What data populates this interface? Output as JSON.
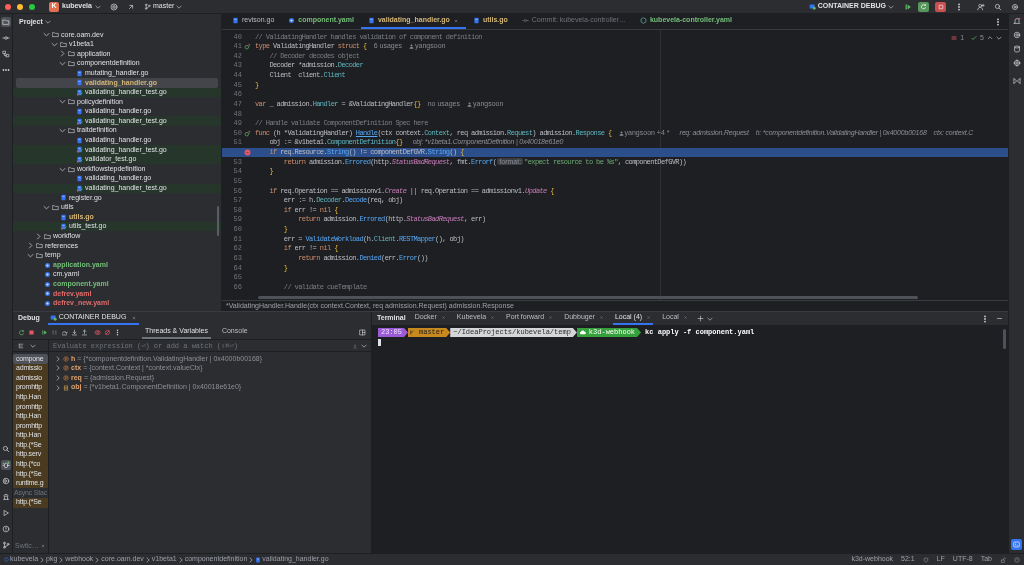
{
  "title_bar": {
    "project_badge": "K",
    "project": "kubevela",
    "branch": "master",
    "run_config": "CONTAINER DEBUG"
  },
  "left_toolbar": {
    "top": [
      {
        "kind": "project",
        "selected": true
      },
      {
        "kind": "commit",
        "selected": false
      },
      {
        "kind": "structure",
        "selected": false
      },
      {
        "kind": "more",
        "selected": false
      }
    ],
    "bottom": [
      {
        "kind": "find",
        "selected": false
      },
      {
        "kind": "debug",
        "selected": true
      },
      {
        "kind": "services",
        "selected": false
      },
      {
        "kind": "build",
        "selected": false
      },
      {
        "kind": "run",
        "selected": false
      },
      {
        "kind": "problems",
        "selected": false
      },
      {
        "kind": "git",
        "selected": false
      }
    ]
  },
  "project_panel": {
    "title": "Project",
    "tree": [
      {
        "children": [
          {
            "children": [
              {
                "name": "core.oam.dev",
                "kind": "folder",
                "expanded": true,
                "selected": false,
                "children": [
                  {
                    "name": "v1beta1",
                    "kind": "folder",
                    "expanded": true,
                    "selected": false,
                    "children": [
                      {
                        "name": "application",
                        "kind": "folder",
                        "expanded": false,
                        "selected": false
                      },
                      {
                        "name": "componentdefinition",
                        "kind": "folder",
                        "expanded": true,
                        "selected": false,
                        "children": [
                          {
                            "name": "mutating_handler.go",
                            "kind": "go",
                            "selected": false
                          },
                          {
                            "name": "validating_handler.go",
                            "kind": "go",
                            "selected": true,
                            "color": "#d5b778"
                          },
                          {
                            "name": "validating_handler_test.go",
                            "kind": "gotest",
                            "selected": false
                          }
                        ]
                      },
                      {
                        "name": "policydefinition",
                        "kind": "folder",
                        "expanded": true,
                        "selected": false,
                        "children": [
                          {
                            "name": "validating_handler.go",
                            "kind": "go",
                            "selected": false
                          },
                          {
                            "name": "validating_handler_test.go",
                            "kind": "gotest",
                            "selected": false
                          }
                        ]
                      },
                      {
                        "name": "traitdefinition",
                        "kind": "folder",
                        "expanded": true,
                        "selected": false,
                        "children": [
                          {
                            "name": "validating_handler.go",
                            "kind": "go",
                            "selected": false
                          },
                          {
                            "name": "validating_handler_test.go",
                            "kind": "gotest",
                            "selected": false
                          },
                          {
                            "name": "validator_test.go",
                            "kind": "gotest",
                            "selected": false
                          }
                        ]
                      },
                      {
                        "name": "workflowstepdefinition",
                        "kind": "folder",
                        "expanded": true,
                        "selected": false,
                        "children": [
                          {
                            "name": "validating_handler.go",
                            "kind": "go",
                            "selected": false
                          },
                          {
                            "name": "validating_handler_test.go",
                            "kind": "gotest",
                            "selected": false
                          }
                        ]
                      }
                    ]
                  },
                  {
                    "name": "register.go",
                    "kind": "go",
                    "selected": false
                  }
                ]
              },
              {
                "name": "utils",
                "kind": "folder",
                "expanded": true,
                "selected": false,
                "children": [
                  {
                    "name": "utils.go",
                    "kind": "go",
                    "selected": false,
                    "color": "#d5b778"
                  },
                  {
                    "name": "utils_test.go",
                    "kind": "gotest",
                    "selected": false
                  }
                ]
              }
            ]
          },
          {
            "name": "workflow",
            "kind": "folder",
            "expanded": false,
            "selected": false
          }
        ]
      },
      {
        "name": "references",
        "kind": "folder",
        "expanded": false,
        "selected": false
      },
      {
        "name": "temp",
        "kind": "folder",
        "expanded": true,
        "selected": false,
        "children": [
          {
            "name": "application.yaml",
            "kind": "yaml",
            "selected": false,
            "color": "#73bd79"
          },
          {
            "name": "cm.yaml",
            "kind": "yaml",
            "selected": false
          },
          {
            "name": "component.yaml",
            "kind": "yaml",
            "selected": false,
            "color": "#73bd79"
          },
          {
            "name": "defrev.yaml",
            "kind": "yaml",
            "selected": false,
            "color": "#e06c6c"
          },
          {
            "name": "defrev_new.yaml",
            "kind": "yaml",
            "selected": false,
            "color": "#e06c6c"
          }
        ]
      }
    ]
  },
  "editor": {
    "tabs": [
      {
        "label": "revison.go",
        "kind": "go",
        "selected": false
      },
      {
        "label": "component.yaml",
        "kind": "yaml",
        "selected": false,
        "color": "#73bd79"
      },
      {
        "label": "validating_handler.go",
        "kind": "go",
        "selected": true,
        "color": "#d5b778"
      },
      {
        "label": "utils.go",
        "kind": "go",
        "selected": false,
        "color": "#d5b778"
      },
      {
        "label": "Commit: kubevela-controller…",
        "kind": "commit",
        "selected": false
      },
      {
        "label": "kubevela-controller.yaml",
        "kind": "k8s",
        "selected": false,
        "color": "#73bd79"
      }
    ],
    "problems": {
      "errors": "1",
      "checks": "5"
    },
    "lines": [
      {
        "number": "40",
        "kind": "plain",
        "current": false,
        "segments": [
          {
            "kind": "comment",
            "text": "// ValidatingHandler handles validation of component definition"
          }
        ]
      },
      {
        "number": "41",
        "kind": "implements",
        "current": false,
        "segments": [
          {
            "kind": "kw",
            "text": "type "
          },
          {
            "kind": "plain",
            "text": "ValidatingHandler "
          },
          {
            "kind": "kw",
            "text": "struct "
          },
          {
            "kind": "brace",
            "text": "{"
          },
          {
            "kind": "hint",
            "text": "6 usages"
          },
          {
            "kind": "author",
            "text": "yangsoon"
          }
        ]
      },
      {
        "number": "42",
        "kind": "plain",
        "current": false,
        "segments": [
          {
            "kind": "comment",
            "text": "    // Decoder decodes object"
          }
        ]
      },
      {
        "number": "43",
        "kind": "plain",
        "current": false,
        "segments": [
          {
            "kind": "plain",
            "text": "    Decoder *admission."
          },
          {
            "kind": "type",
            "text": "Decoder"
          }
        ]
      },
      {
        "number": "44",
        "kind": "plain",
        "current": false,
        "segments": [
          {
            "kind": "plain",
            "text": "    Client  client."
          },
          {
            "kind": "type",
            "text": "Client"
          }
        ]
      },
      {
        "number": "45",
        "kind": "plain",
        "current": false,
        "segments": [
          {
            "kind": "brace",
            "text": "}"
          }
        ]
      },
      {
        "number": "46",
        "kind": "plain",
        "current": false
      },
      {
        "number": "47",
        "kind": "plain",
        "current": false,
        "segments": [
          {
            "kind": "kw",
            "text": "var "
          },
          {
            "kind": "plain",
            "text": "_ admission."
          },
          {
            "kind": "type",
            "text": "Handler"
          },
          {
            "kind": "plain",
            "text": " = &ValidatingHandler"
          },
          {
            "kind": "brace",
            "text": "{}"
          },
          {
            "kind": "hint",
            "text": "no usages"
          },
          {
            "kind": "author",
            "text": "yangsoon"
          }
        ]
      },
      {
        "number": "48",
        "kind": "plain",
        "current": false
      },
      {
        "number": "49",
        "kind": "plain",
        "current": false,
        "segments": [
          {
            "kind": "comment",
            "text": "// Handle validate ComponentDefinition Spec here"
          }
        ]
      },
      {
        "number": "50",
        "kind": "implements",
        "current": false,
        "segments": [
          {
            "kind": "kw",
            "text": "func "
          },
          {
            "kind": "plain",
            "text": "(h *ValidatingHandler) "
          },
          {
            "kind": "decl",
            "text": "Handle"
          },
          {
            "kind": "plain",
            "text": "(ctx context."
          },
          {
            "kind": "type",
            "text": "Context"
          },
          {
            "kind": "plain",
            "text": ", req admission."
          },
          {
            "kind": "type",
            "text": "Request"
          },
          {
            "kind": "plain",
            "text": ") admission."
          },
          {
            "kind": "type",
            "text": "Response "
          },
          {
            "kind": "brace",
            "text": "{"
          },
          {
            "kind": "author",
            "text": "yangsoon +4 *"
          },
          {
            "kind": "debug",
            "text": "req: admission.Request"
          },
          {
            "kind": "debug",
            "text": "h: *componentdefinition.ValidatingHandler | 0x4000b00168"
          },
          {
            "kind": "debug",
            "text": "ctx: context.C"
          }
        ]
      },
      {
        "number": "51",
        "kind": "plain",
        "current": false,
        "segments": [
          {
            "kind": "plain",
            "text": "    obj := &v1beta1."
          },
          {
            "kind": "type",
            "text": "ComponentDefinition"
          },
          {
            "kind": "brace",
            "text": "{}"
          },
          {
            "kind": "debug",
            "text": "obj: *v1beta1.ComponentDefinition | 0x40018e61e0"
          }
        ]
      },
      {
        "kind": "breakpoint",
        "current": true,
        "segments": [
          {
            "kind": "kw",
            "text": "    if "
          },
          {
            "kind": "plain",
            "text": "req.Resource."
          },
          {
            "kind": "func",
            "text": "String"
          },
          {
            "kind": "plain",
            "text": "() != componentDefGVR."
          },
          {
            "kind": "func",
            "text": "String"
          },
          {
            "kind": "plain",
            "text": "() "
          },
          {
            "kind": "brace",
            "text": "{"
          }
        ]
      },
      {
        "number": "53",
        "kind": "plain",
        "current": false,
        "segments": [
          {
            "kind": "kw",
            "text": "        return "
          },
          {
            "kind": "plain",
            "text": "admission."
          },
          {
            "kind": "func",
            "text": "Errored"
          },
          {
            "kind": "plain",
            "text": "(http."
          },
          {
            "kind": "const",
            "text": "StatusBadRequest"
          },
          {
            "kind": "plain",
            "text": ", fmt."
          },
          {
            "kind": "func",
            "text": "Errorf"
          },
          {
            "kind": "plain",
            "text": "("
          },
          {
            "kind": "inlay",
            "text": "format:"
          },
          {
            "kind": "str",
            "text": "\"expect resource to be %s\""
          },
          {
            "kind": "plain",
            "text": ", componentDefGVR))"
          }
        ]
      },
      {
        "number": "54",
        "kind": "plain",
        "current": false,
        "segments": [
          {
            "kind": "brace",
            "text": "    }"
          }
        ]
      },
      {
        "number": "55",
        "kind": "plain",
        "current": false
      },
      {
        "number": "56",
        "kind": "plain",
        "current": false,
        "segments": [
          {
            "kind": "kw",
            "text": "    if "
          },
          {
            "kind": "plain",
            "text": "req.Operation == admissionv1."
          },
          {
            "kind": "const",
            "text": "Create"
          },
          {
            "kind": "plain",
            "text": " || req.Operation == admissionv1."
          },
          {
            "kind": "const",
            "text": "Update "
          },
          {
            "kind": "brace",
            "text": "{"
          }
        ]
      },
      {
        "number": "57",
        "kind": "plain",
        "current": false,
        "segments": [
          {
            "kind": "plain",
            "text": "        err := h."
          },
          {
            "kind": "type",
            "text": "Decoder"
          },
          {
            "kind": "plain",
            "text": "."
          },
          {
            "kind": "func",
            "text": "Decode"
          },
          {
            "kind": "plain",
            "text": "(req, obj)"
          }
        ]
      },
      {
        "number": "58",
        "kind": "plain",
        "current": false,
        "segments": [
          {
            "kind": "kw",
            "text": "        if "
          },
          {
            "kind": "plain",
            "text": "err != "
          },
          {
            "kind": "kw",
            "text": "nil "
          },
          {
            "kind": "brace",
            "text": "{"
          }
        ]
      },
      {
        "number": "59",
        "kind": "plain",
        "current": false,
        "segments": [
          {
            "kind": "kw",
            "text": "            return "
          },
          {
            "kind": "plain",
            "text": "admission."
          },
          {
            "kind": "func",
            "text": "Errored"
          },
          {
            "kind": "plain",
            "text": "(http."
          },
          {
            "kind": "const",
            "text": "StatusBadRequest"
          },
          {
            "kind": "plain",
            "text": ", err)"
          }
        ]
      },
      {
        "number": "60",
        "kind": "plain",
        "current": false,
        "segments": [
          {
            "kind": "brace",
            "text": "        }"
          }
        ]
      },
      {
        "number": "61",
        "kind": "plain",
        "current": false,
        "segments": [
          {
            "kind": "plain",
            "text": "        err = "
          },
          {
            "kind": "func",
            "text": "ValidateWorkload"
          },
          {
            "kind": "plain",
            "text": "(h."
          },
          {
            "kind": "type",
            "text": "Client"
          },
          {
            "kind": "plain",
            "text": "."
          },
          {
            "kind": "func",
            "text": "RESTMapper"
          },
          {
            "kind": "plain",
            "text": "(), obj)"
          }
        ]
      },
      {
        "number": "62",
        "kind": "plain",
        "current": false,
        "segments": [
          {
            "kind": "kw",
            "text": "        if "
          },
          {
            "kind": "plain",
            "text": "err != "
          },
          {
            "kind": "kw",
            "text": "nil "
          },
          {
            "kind": "brace",
            "text": "{"
          }
        ]
      },
      {
        "number": "63",
        "kind": "plain",
        "current": false,
        "segments": [
          {
            "kind": "kw",
            "text": "            return "
          },
          {
            "kind": "plain",
            "text": "admission."
          },
          {
            "kind": "func",
            "text": "Denied"
          },
          {
            "kind": "plain",
            "text": "(err."
          },
          {
            "kind": "func",
            "text": "Error"
          },
          {
            "kind": "plain",
            "text": "())"
          }
        ]
      },
      {
        "number": "64",
        "kind": "plain",
        "current": false,
        "segments": [
          {
            "kind": "brace",
            "text": "        }"
          }
        ]
      },
      {
        "number": "65",
        "kind": "plain",
        "current": false
      },
      {
        "number": "66",
        "kind": "plain",
        "current": false,
        "segments": [
          {
            "kind": "comment",
            "text": "        // validate cueTemplate"
          }
        ]
      }
    ],
    "breadcrumb": "*ValidatingHandler.Handle(ctx context.Context, req admission.Request) admission.Response"
  },
  "debug_panel": {
    "title": "Debug",
    "session_tab": "CONTAINER DEBUG",
    "view_tabs": [
      {
        "label": "Threads & Variables",
        "selected": true
      },
      {
        "label": "Console",
        "selected": false
      }
    ],
    "evaluate_placeholder": "Evaluate expression (⏎) or add a watch (⇧⌘⏎)",
    "frames": [
      {
        "label": "compone",
        "kind": "frame",
        "selected": true
      },
      {
        "label": "admissio",
        "kind": "library",
        "selected": false
      },
      {
        "label": "admissio",
        "kind": "library",
        "selected": false
      },
      {
        "label": "promhttp",
        "kind": "library",
        "selected": false
      },
      {
        "label": "http.Han",
        "kind": "library",
        "selected": false
      },
      {
        "label": "promhttp",
        "kind": "library",
        "selected": false
      },
      {
        "label": "http.Han",
        "kind": "library",
        "selected": false
      },
      {
        "label": "promhttp",
        "kind": "library",
        "selected": false
      },
      {
        "label": "http.Han",
        "kind": "library",
        "selected": false
      },
      {
        "label": "http.(*Se",
        "kind": "library",
        "selected": false
      },
      {
        "label": "http.serv",
        "kind": "library",
        "selected": false
      },
      {
        "label": "http.(*co",
        "kind": "library",
        "selected": false
      },
      {
        "label": "http.(*Se",
        "kind": "library",
        "selected": false
      },
      {
        "label": "runtime.g",
        "kind": "library",
        "selected": false
      },
      {
        "label": "Async Stac",
        "kind": "header",
        "selected": false
      },
      {
        "label": "http.(*Se",
        "kind": "library",
        "selected": false
      }
    ],
    "switcher": "Switc…",
    "variables": [
      {
        "name": "h",
        "kind": "param",
        "value": "= {*componentdefinition.ValidatingHandler | 0x4000b00168}"
      },
      {
        "name": "ctx",
        "kind": "param",
        "value": "= {context.Context | *context.valueCtx}"
      },
      {
        "name": "req",
        "kind": "param",
        "value": "= {admission.Request}"
      },
      {
        "name": "obj",
        "kind": "local",
        "value": "= {*v1beta1.ComponentDefinition | 0x40018e61e0}"
      }
    ]
  },
  "terminal": {
    "title": "Terminal",
    "tabs": [
      {
        "label": "Docker",
        "selected": false
      },
      {
        "label": "Kubevela",
        "selected": false
      },
      {
        "label": "Port forward",
        "selected": false
      },
      {
        "label": "Dubbuger",
        "selected": false
      },
      {
        "label": "Local (4)",
        "selected": true
      },
      {
        "label": "Local",
        "selected": false
      }
    ],
    "prompt": [
      {
        "kind": "time",
        "text": "23:05"
      },
      {
        "kind": "branch",
        "text": "master"
      },
      {
        "kind": "path",
        "text": "~/IdeaProjects/kubevela/temp"
      },
      {
        "kind": "context",
        "text": "k3d-webhook"
      }
    ],
    "command": "kc apply -f component.yaml"
  },
  "status_bar": {
    "breadcrumbs": [
      {
        "label": "kubevela",
        "kind": "project"
      },
      {
        "label": "pkg",
        "kind": "folder"
      },
      {
        "label": "webhook",
        "kind": "folder"
      },
      {
        "label": "core.oam.dev",
        "kind": "folder"
      },
      {
        "label": "v1beta1",
        "kind": "folder"
      },
      {
        "label": "componentdefinition",
        "kind": "folder"
      },
      {
        "label": "validating_handler.go",
        "kind": "go"
      }
    ],
    "items": [
      "k3d-webhook",
      "52:1",
      "LF",
      "UTF-8",
      "Tab"
    ]
  }
}
